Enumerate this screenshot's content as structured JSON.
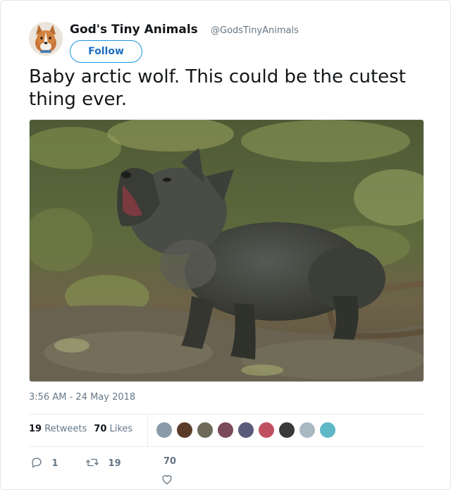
{
  "author": {
    "display_name": "God's Tiny Animals",
    "handle": "@GodsTinyAnimals",
    "avatar": "corgi-puppy-avatar"
  },
  "follow_button": {
    "label": "Follow"
  },
  "tweet": {
    "text": "Baby arctic wolf. This could be the cutest thing ever.",
    "media": "photo-howling-wolf-pup"
  },
  "timestamp": "3:56 AM - 24 May 2018",
  "stats": {
    "retweets_count": "19",
    "retweets_label": "Retweets",
    "likes_count": "70",
    "likes_label": "Likes"
  },
  "likers": [
    {
      "name": "liker-avatar-1",
      "color": "#8a9aa8"
    },
    {
      "name": "liker-avatar-2",
      "color": "#5a3b2a"
    },
    {
      "name": "liker-avatar-3",
      "color": "#6e6a5a"
    },
    {
      "name": "liker-avatar-4",
      "color": "#7a4a5a"
    },
    {
      "name": "liker-avatar-5",
      "color": "#5a5a7a"
    },
    {
      "name": "liker-avatar-6",
      "color": "#c05060"
    },
    {
      "name": "liker-avatar-7",
      "color": "#3a3a3a"
    },
    {
      "name": "liker-avatar-8",
      "color": "#aab8c2"
    },
    {
      "name": "liker-avatar-9",
      "color": "#5fb8c8"
    }
  ],
  "actions": {
    "reply_count": "1",
    "retweet_count": "19",
    "like_count": "70"
  },
  "colors": {
    "text": "#14171a",
    "secondary": "#657786",
    "accent": "#1b95e0",
    "divider": "#e6ecf0"
  }
}
